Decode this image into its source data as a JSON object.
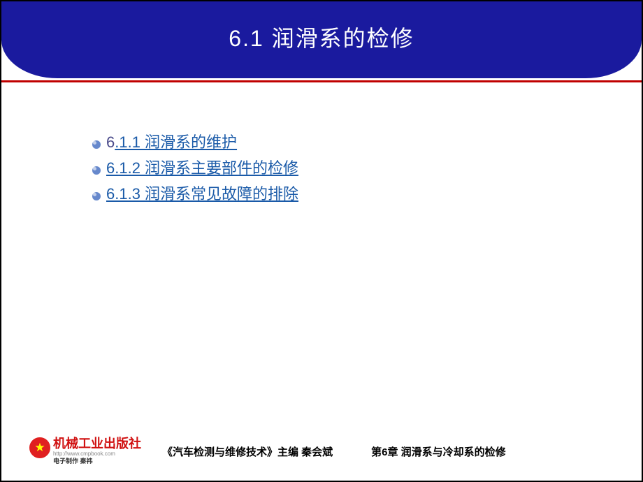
{
  "header": {
    "title": "6.1  润滑系的检修"
  },
  "items": [
    {
      "num_plain": "6",
      "link": ".1.1  润滑系的维护"
    },
    {
      "num_plain": "",
      "link": "6.1.2  润滑系主要部件的检修"
    },
    {
      "num_plain": "",
      "link": "6.1.3  润滑系常见故障的排除"
    }
  ],
  "footer": {
    "publisher_name": "机械工业出版社",
    "publisher_url": "http://www.cmpbook.com",
    "maker": "电子制作  秦祎",
    "book": "《汽车检测与维修技术》主编 秦会斌",
    "chapter": "第6章  润滑系与冷却系的检修"
  }
}
